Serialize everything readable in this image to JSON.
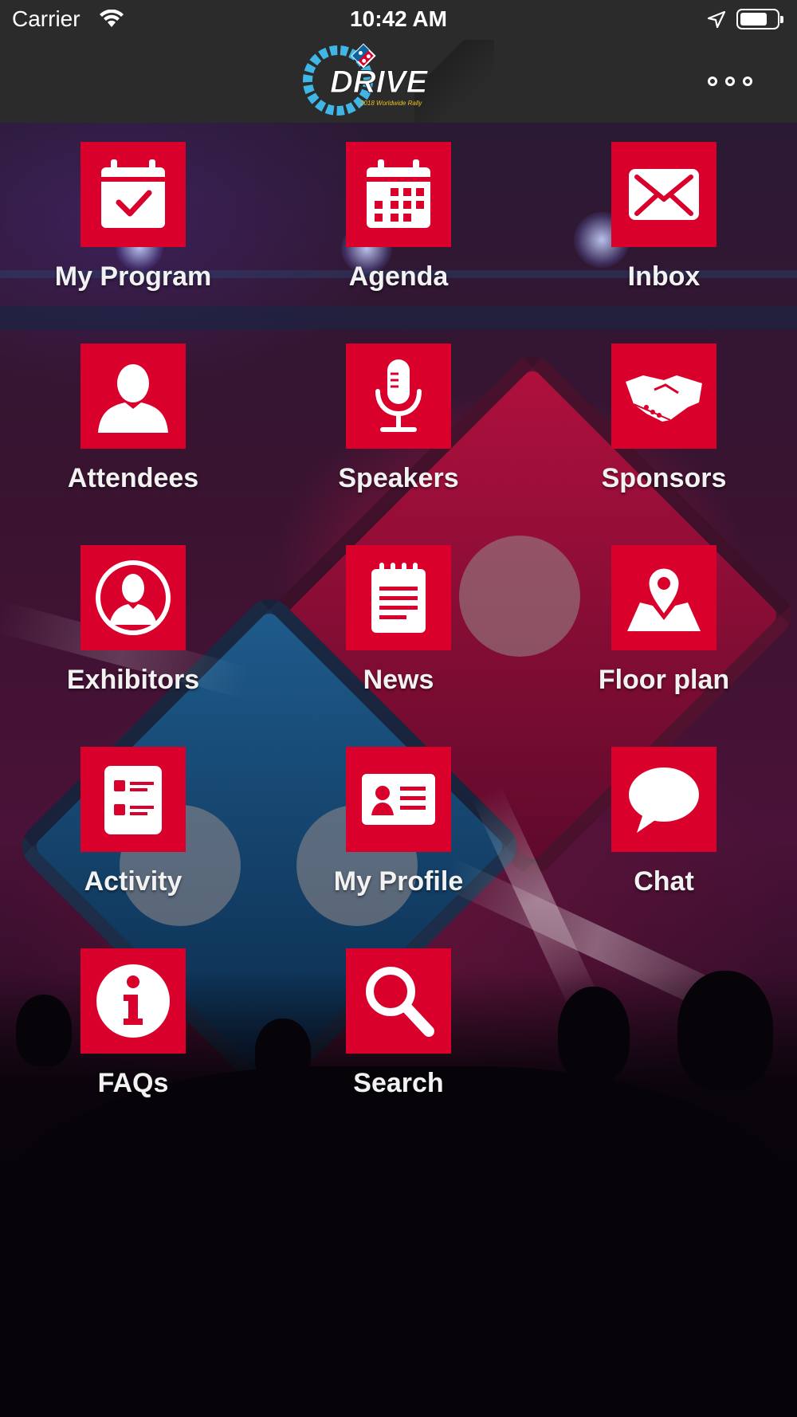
{
  "status_bar": {
    "carrier": "Carrier",
    "time": "10:42 AM",
    "battery_level": 0.75
  },
  "header": {
    "logo_text": "DRIVE",
    "logo_subtitle": "2018 Worldwide Rally",
    "more_icon": "more-dots-icon"
  },
  "menu": {
    "items": [
      {
        "label": "My Program",
        "icon": "calendar-check-icon"
      },
      {
        "label": "Agenda",
        "icon": "calendar-grid-icon"
      },
      {
        "label": "Inbox",
        "icon": "envelope-icon"
      },
      {
        "label": "Attendees",
        "icon": "person-icon"
      },
      {
        "label": "Speakers",
        "icon": "microphone-icon"
      },
      {
        "label": "Sponsors",
        "icon": "handshake-icon"
      },
      {
        "label": "Exhibitors",
        "icon": "person-circle-icon"
      },
      {
        "label": "News",
        "icon": "notepad-icon"
      },
      {
        "label": "Floor plan",
        "icon": "map-pin-icon"
      },
      {
        "label": "Activity",
        "icon": "checklist-icon"
      },
      {
        "label": "My Profile",
        "icon": "id-card-icon"
      },
      {
        "label": "Chat",
        "icon": "speech-bubble-icon"
      },
      {
        "label": "FAQs",
        "icon": "info-icon"
      },
      {
        "label": "Search",
        "icon": "magnifier-icon"
      }
    ]
  },
  "colors": {
    "tile_red": "#d9002b",
    "bar_background": "#2b2b2b",
    "label_text": "#f2f2f2"
  }
}
